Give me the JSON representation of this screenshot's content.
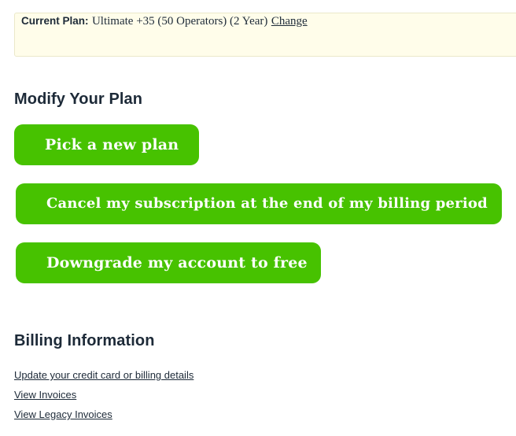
{
  "current_plan": {
    "label": "Current Plan:",
    "value": "Ultimate +35 (50 Operators) (2 Year)",
    "change_link": "Change"
  },
  "modify_section": {
    "heading": "Modify Your Plan",
    "buttons": [
      {
        "label": "Pick a new plan"
      },
      {
        "label": "Cancel my subscription at the end of my billing period"
      },
      {
        "label": "Downgrade my account to free"
      }
    ],
    "button_color": "#47c200"
  },
  "billing_section": {
    "heading": "Billing Information",
    "links": [
      {
        "label": "Update your credit card or billing details"
      },
      {
        "label": "View Invoices"
      },
      {
        "label": "View Legacy Invoices"
      }
    ]
  }
}
